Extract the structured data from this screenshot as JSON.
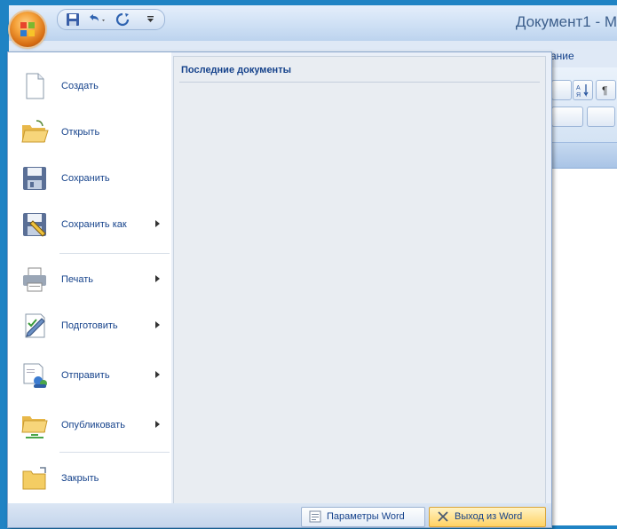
{
  "window": {
    "title": "Документ1 - М"
  },
  "ribbon": {
    "tab_fragment": "ание"
  },
  "office_menu": {
    "recent_documents_title": "Последние документы",
    "items": [
      {
        "label": "Создать",
        "icon": "new-document-icon",
        "has_submenu": false
      },
      {
        "label": "Открыть",
        "icon": "open-folder-icon",
        "has_submenu": false
      },
      {
        "label": "Сохранить",
        "icon": "floppy-disk-icon",
        "has_submenu": false
      },
      {
        "label": "Сохранить как",
        "icon": "save-as-icon",
        "has_submenu": true
      },
      {
        "label": "Печать",
        "icon": "printer-icon",
        "has_submenu": true
      },
      {
        "label": "Подготовить",
        "icon": "prepare-pen-icon",
        "has_submenu": true
      },
      {
        "label": "Отправить",
        "icon": "send-icon",
        "has_submenu": true
      },
      {
        "label": "Опубликовать",
        "icon": "publish-folder-icon",
        "has_submenu": true
      },
      {
        "label": "Закрыть",
        "icon": "close-folder-icon",
        "has_submenu": false
      }
    ],
    "options_button": "Параметры Word",
    "exit_button": "Выход из Word"
  },
  "colors": {
    "frame": "#1f83c4",
    "menu_text": "#15428b",
    "exit_button": "#ffd264"
  }
}
